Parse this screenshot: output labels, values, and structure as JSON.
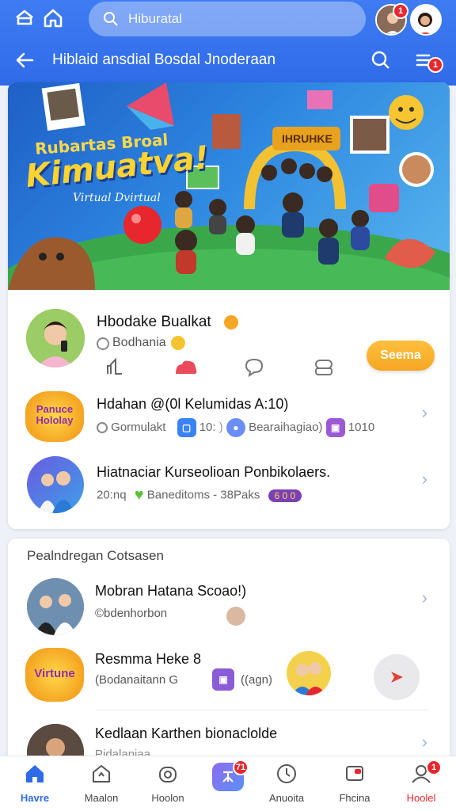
{
  "topbar": {
    "search_value": "Hiburatal",
    "title": "Hiblaid ansdial Bosdal Jnoderaan",
    "avatar_badge": "1",
    "menu_badge": "1"
  },
  "profile": {
    "name": "Hbodake Bualkat",
    "sub": "Bodhania",
    "action_button": "Seema"
  },
  "feed": [
    {
      "title": "Hdahan @(0l Kelumidas A:10)",
      "meta": [
        "Gormulakt",
        "10:",
        "Bearaihagiao)",
        "1010"
      ],
      "badge_text": "Panuce Hololay"
    },
    {
      "title": "Hiatnaciar Kurseolioan Ponbikolaers.",
      "meta": [
        "20:nq",
        "Baneditoms - 38Paks",
        "6 0 0"
      ]
    }
  ],
  "section2": {
    "heading": "Pealndregan Cotsasen",
    "items": [
      {
        "title": "Mobran Hatana Scoao!)",
        "sub": "©bdenhorbon"
      },
      {
        "title": "Resmma Heke 8",
        "sub": "(Bodanaitann G",
        "sub2": "((agn)",
        "badge_text": "Virtune"
      },
      {
        "title": "Kedlaan Karthen bionaclolde",
        "sub": "Pidalaniaa"
      }
    ]
  },
  "banner": {
    "headline_top": "Rubartas Broal",
    "headline_big": "Kimuatva!",
    "headline_sub": "Virtual Dvirtual",
    "sign": "IHRUHKE"
  },
  "bottom_nav": [
    {
      "label": "Havre",
      "active": true
    },
    {
      "label": "Maalon"
    },
    {
      "label": "Hoolon"
    },
    {
      "label": "",
      "badge": "71"
    },
    {
      "label": "Anuoita"
    },
    {
      "label": "Fhcina"
    },
    {
      "label": "Hoolel",
      "badge": "1"
    }
  ],
  "colors": {
    "primary": "#2f6be8",
    "orange": "#f5a623",
    "red": "#e8262d"
  }
}
